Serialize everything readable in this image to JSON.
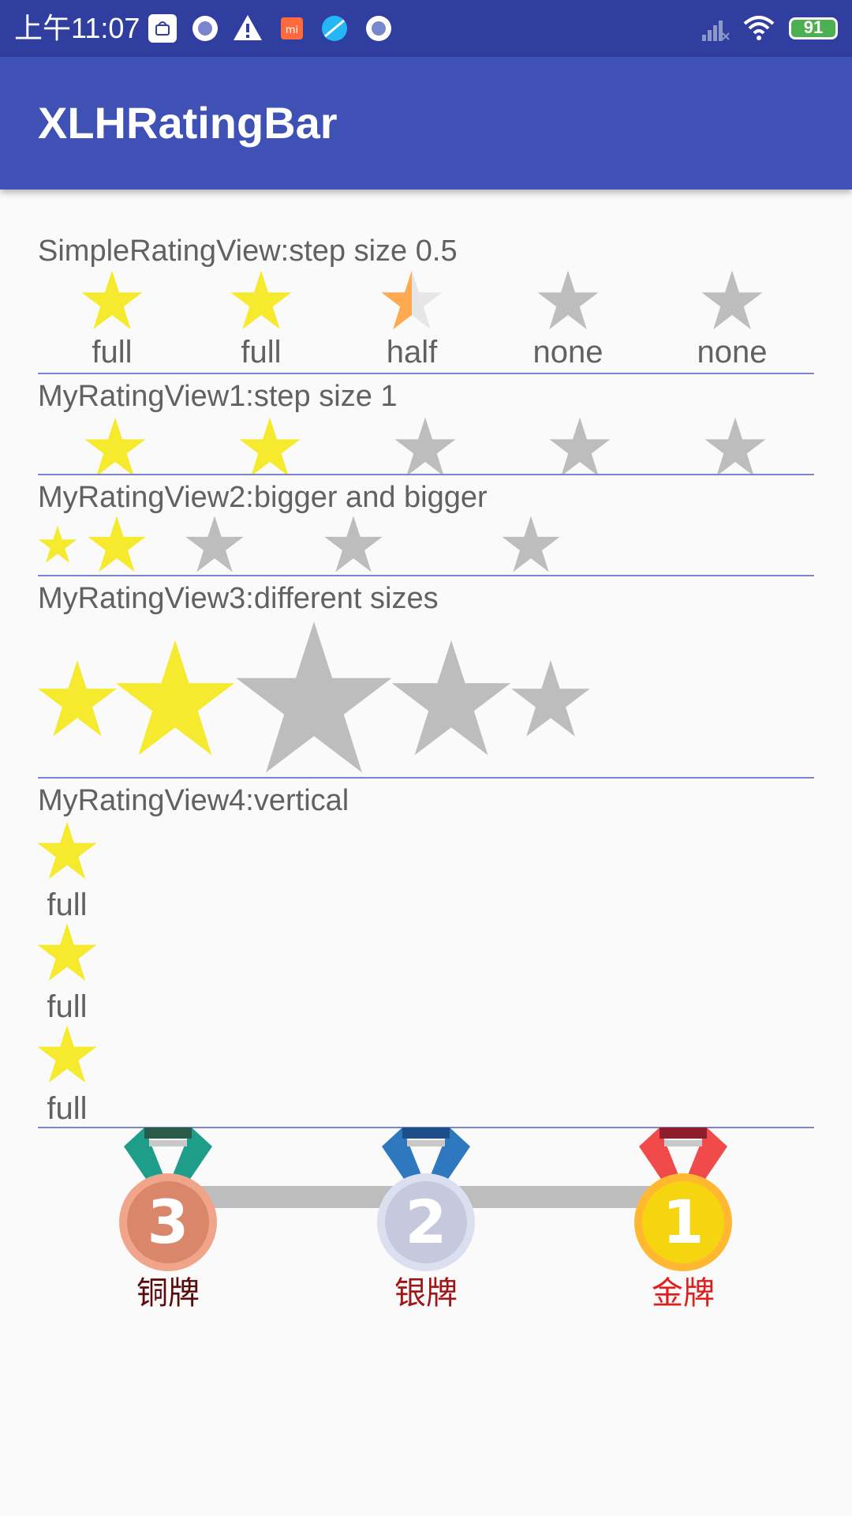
{
  "status_bar": {
    "time": "上午11:07",
    "battery": "91",
    "icons": [
      "mi-store-icon",
      "circle-app-icon",
      "warning-icon",
      "mi-icon",
      "browser-icon",
      "circle-app-icon",
      "signal-icon",
      "wifi-icon",
      "battery-icon"
    ]
  },
  "app_bar": {
    "title": "XLHRatingBar"
  },
  "colors": {
    "full": "#f5ea2d",
    "empty": "#bdbdbd",
    "half": "#ffaa50",
    "half_empty": "#e6e6e6",
    "primary": "#3f51b5",
    "primary_dark": "#303f9f",
    "divider": "#7986cb"
  },
  "simple_rating": {
    "heading": "SimpleRatingView:step size 0.5",
    "rating": 2.5,
    "stars": [
      {
        "state": "full",
        "label": "full"
      },
      {
        "state": "full",
        "label": "full"
      },
      {
        "state": "half",
        "label": "half"
      },
      {
        "state": "none",
        "label": "none"
      },
      {
        "state": "none",
        "label": "none"
      }
    ]
  },
  "rating1": {
    "heading": "MyRatingView1:step size 1",
    "rating": 2,
    "count": 5
  },
  "rating2": {
    "heading": "MyRatingView2:bigger and bigger",
    "rating": 2,
    "count": 5
  },
  "rating3": {
    "heading": "MyRatingView3:different sizes",
    "rating": 2,
    "count": 5
  },
  "rating4": {
    "heading": "MyRatingView4:vertical",
    "stars": [
      {
        "state": "full",
        "label": "full"
      },
      {
        "state": "full",
        "label": "full"
      },
      {
        "state": "full",
        "label": "full"
      }
    ]
  },
  "medals": [
    {
      "number": "3",
      "label": "铜牌",
      "label_color": "#5a0a0a"
    },
    {
      "number": "2",
      "label": "银牌",
      "label_color": "#a01515"
    },
    {
      "number": "1",
      "label": "金牌",
      "label_color": "#e01e1e"
    }
  ]
}
